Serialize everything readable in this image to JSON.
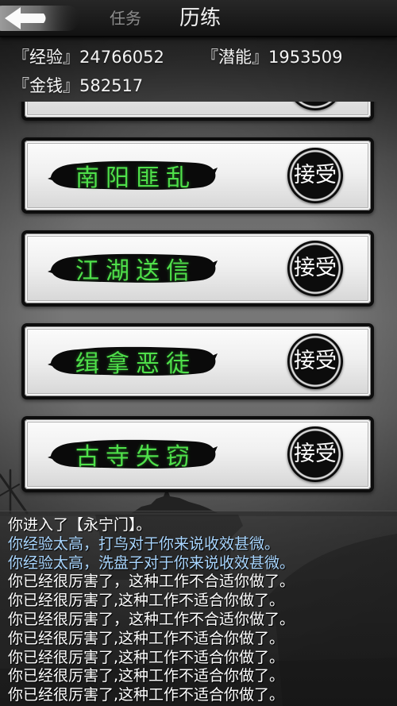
{
  "header": {
    "back_icon": "back-arrow-icon",
    "tab_task": "任务",
    "tab_training": "历练"
  },
  "stats": {
    "exp": {
      "label": "『经验』",
      "value": "24766052"
    },
    "potential": {
      "label": "『潜能』",
      "value": "1953509"
    },
    "money": {
      "label": "『金钱』",
      "value": "582517"
    }
  },
  "quests": [
    {
      "title": "南阳匪乱",
      "accept_label": "接受"
    },
    {
      "title": "江湖送信",
      "accept_label": "接受"
    },
    {
      "title": "缉拿恶徒",
      "accept_label": "接受"
    },
    {
      "title": "古寺失窃",
      "accept_label": "接受"
    }
  ],
  "log": [
    {
      "text": "你进入了【永宁门】。",
      "color": "#ffffff"
    },
    {
      "text": "你经验太高，打鸟对于你来说收效甚微。",
      "color": "#a9d6ff"
    },
    {
      "text": "你经验太高，洗盘子对于你来说收效甚微。",
      "color": "#a9d6ff"
    },
    {
      "text": "你已经很厉害了，这种工作不合适你做了。",
      "color": "#ffffff"
    },
    {
      "text": "你已经很厉害了,这种工作不适合你做了。",
      "color": "#ffffff"
    },
    {
      "text": "你已经很厉害了，这种工作不合适你做了。",
      "color": "#ffffff"
    },
    {
      "text": "你已经很厉害了,这种工作不适合你做了。",
      "color": "#ffffff"
    },
    {
      "text": "你已经很厉害了,这种工作不适合你做了。",
      "color": "#ffffff"
    },
    {
      "text": "你已经很厉害了,这种工作不适合你做了。",
      "color": "#ffffff"
    },
    {
      "text": "你已经很厉害了,这种工作不适合你做了。",
      "color": "#ffffff"
    }
  ],
  "colors": {
    "quest_title": "#4fe04a",
    "accept_text": "#ffffff",
    "stats_text": "#f4f4f4"
  }
}
